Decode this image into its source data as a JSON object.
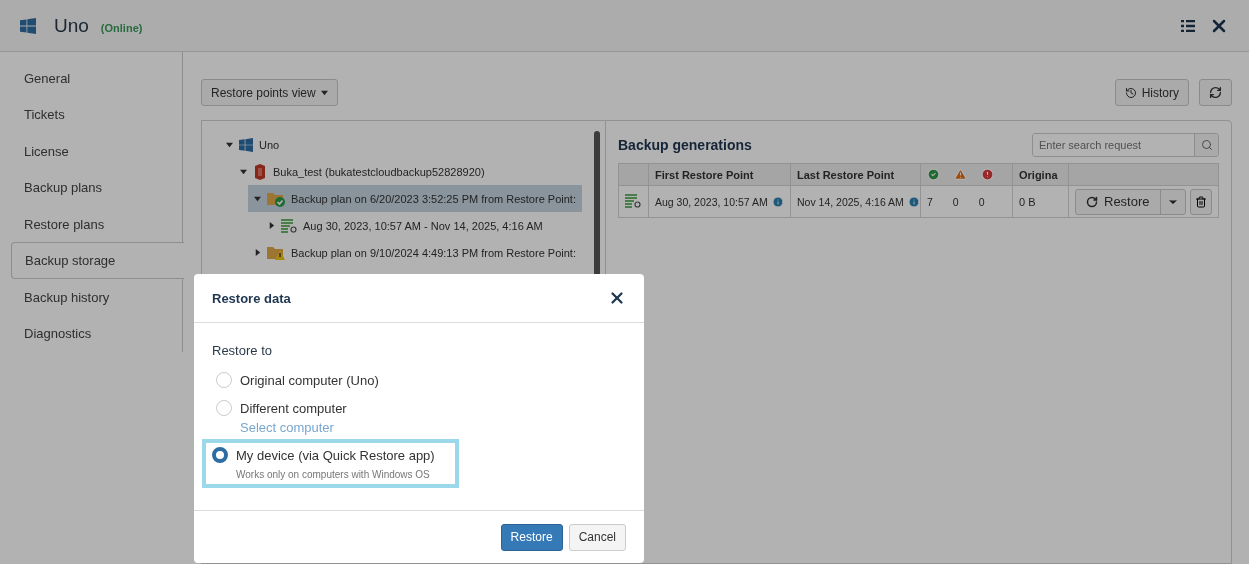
{
  "window": {
    "title": "Uno",
    "status": "(Online)"
  },
  "sidebar": {
    "items": [
      {
        "label": "General",
        "selected": false
      },
      {
        "label": "Tickets",
        "selected": false
      },
      {
        "label": "License",
        "selected": false
      },
      {
        "label": "Backup plans",
        "selected": false
      },
      {
        "label": "Restore plans",
        "selected": false
      },
      {
        "label": "Backup storage",
        "selected": true
      },
      {
        "label": "Backup history",
        "selected": false
      },
      {
        "label": "Diagnostics",
        "selected": false
      }
    ]
  },
  "toolbar": {
    "view_dropdown": "Restore points view",
    "history_button": "History"
  },
  "tree": {
    "nodes": [
      {
        "label": "Uno",
        "kind": "computer",
        "expanded": true,
        "selected": false,
        "children": [
          {
            "label": "Buka_test (bukatestcloudbackup52828920)",
            "kind": "storage",
            "expanded": true,
            "selected": false,
            "children": [
              {
                "label": "Backup plan on 6/20/2023 3:52:25 PM from Restore Point:",
                "kind": "plan-ok",
                "expanded": true,
                "selected": true,
                "children": [
                  {
                    "label": "Aug 30, 2023, 10:57 AM - Nov 14, 2025, 4:16 AM",
                    "kind": "generation",
                    "expanded": false,
                    "selected": false
                  }
                ]
              },
              {
                "label": "Backup plan on 9/10/2024 4:49:13 PM from Restore Point:",
                "kind": "plan-warning",
                "expanded": false,
                "selected": false
              }
            ]
          }
        ]
      }
    ]
  },
  "generations": {
    "title": "Backup generations",
    "search": {
      "placeholder": "Enter search request"
    },
    "columns": [
      "First Restore Point",
      "Last Restore Point",
      "Origina"
    ],
    "rows": [
      {
        "first": "Aug 30, 2023, 10:57 AM",
        "last": "Nov 14, 2025, 4:16 AM",
        "success": "7",
        "warnings": "0",
        "errors": "0",
        "original": "0 B",
        "restore_button": "Restore"
      }
    ]
  },
  "dialog": {
    "title": "Restore data",
    "section": "Restore to",
    "options": [
      {
        "label": "Original computer (Uno)",
        "selected": false,
        "highlighted": false
      },
      {
        "label": "Different computer",
        "selected": false,
        "highlighted": false,
        "link": "Select computer"
      },
      {
        "label": "My device (via Quick Restore app)",
        "selected": true,
        "highlighted": true,
        "note": "Works only on computers with Windows OS"
      }
    ],
    "buttons": [
      {
        "label": "Restore",
        "kind": "primary"
      },
      {
        "label": "Cancel",
        "kind": "secondary"
      }
    ]
  }
}
